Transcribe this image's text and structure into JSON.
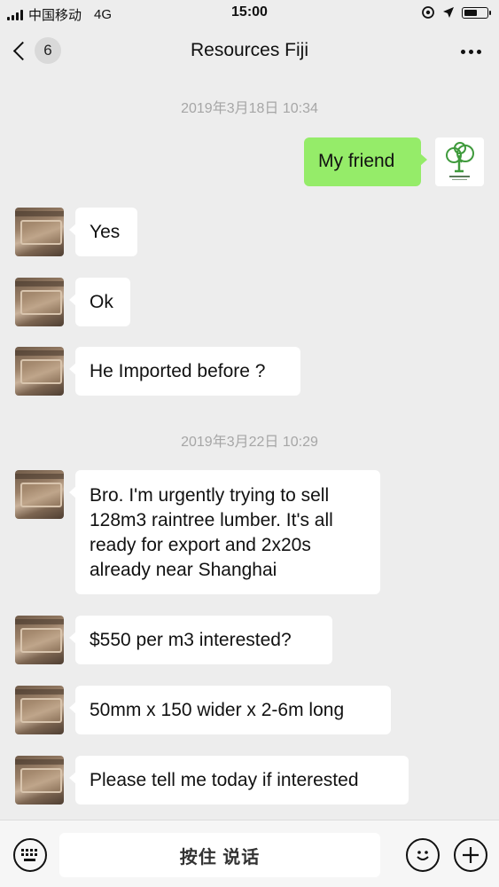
{
  "status_bar": {
    "carrier": "中国移动",
    "network": "4G",
    "time": "15:00"
  },
  "nav": {
    "unread_count": "6",
    "title": "Resources Fiji"
  },
  "messages": [
    {
      "kind": "timestamp",
      "text": "2019年3月18日 10:34"
    },
    {
      "kind": "out",
      "text": "My friend"
    },
    {
      "kind": "in",
      "text": "Yes"
    },
    {
      "kind": "in",
      "text": "Ok"
    },
    {
      "kind": "in",
      "text": "He Imported before ?"
    },
    {
      "kind": "timestamp",
      "text": "2019年3月22日 10:29"
    },
    {
      "kind": "in",
      "lines": [
        "Bro. I'm urgently trying to sell",
        "128m3 raintree lumber. It's all",
        "ready for export and 2x20s",
        "already near Shanghai"
      ]
    },
    {
      "kind": "in",
      "text": "$550 per m3 interested?"
    },
    {
      "kind": "in",
      "text": "50mm x 150 wider x 2-6m long"
    },
    {
      "kind": "in",
      "text": "Please tell me today if interested"
    }
  ],
  "input_bar": {
    "hold_to_talk_label": "按住 说话"
  },
  "colors": {
    "background": "#ededed",
    "outgoing_bubble": "#95ec69",
    "incoming_bubble": "#ffffff",
    "timestamp_text": "#a6a6a6",
    "logo_green": "#3f9a3c"
  },
  "icons": [
    "signal-icon",
    "location-lock-icon",
    "location-arrow-icon",
    "battery-icon",
    "back-chevron-icon",
    "more-dots-icon",
    "keyboard-icon",
    "emoji-icon",
    "plus-icon"
  ]
}
